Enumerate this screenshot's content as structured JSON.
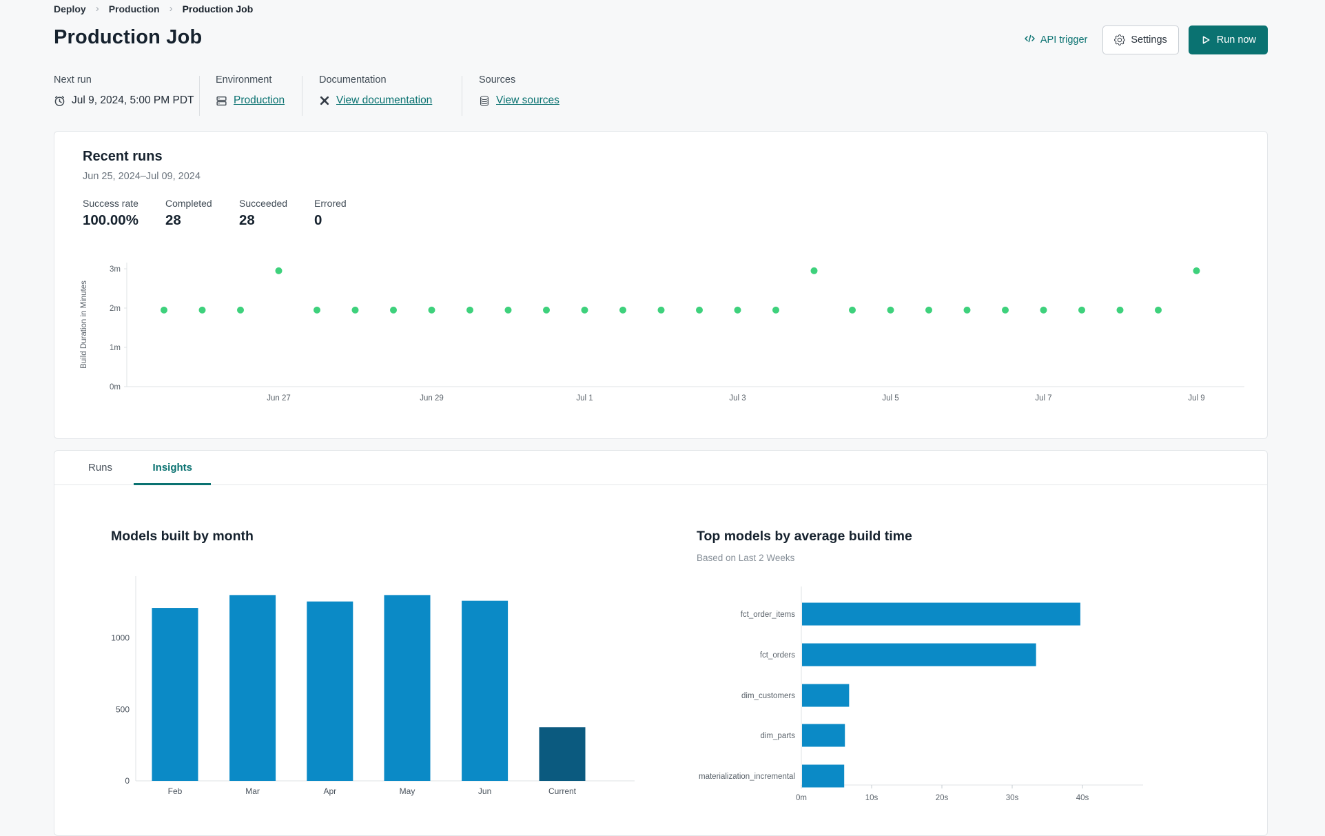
{
  "colors": {
    "accent_teal": "#0a7271",
    "point_green": "#3ed17c",
    "bar_blue": "#0b8ac6",
    "bar_navy": "#0b5a7f"
  },
  "breadcrumb": {
    "deploy": "Deploy",
    "production": "Production",
    "current": "Production Job"
  },
  "header": {
    "title": "Production Job",
    "api_trigger_label": "API trigger",
    "api_trigger_icon": "code-icon",
    "settings_label": "Settings",
    "settings_icon": "gear-icon",
    "run_now_label": "Run now",
    "run_now_icon": "play-icon"
  },
  "meta": {
    "next_run": {
      "label": "Next run",
      "value": "Jul 9, 2024, 5:00 PM PDT",
      "icon": "clock-icon"
    },
    "environment": {
      "label": "Environment",
      "value": "Production",
      "icon": "environment-icon"
    },
    "documentation": {
      "label": "Documentation",
      "value": "View documentation",
      "icon": "dbt-docs-icon"
    },
    "sources": {
      "label": "Sources",
      "value": "View sources",
      "icon": "database-icon"
    }
  },
  "recent_runs": {
    "title": "Recent runs",
    "date_range": "Jun 25, 2024–Jul 09, 2024",
    "stats": {
      "success_rate": {
        "label": "Success rate",
        "value": "100.00%"
      },
      "completed": {
        "label": "Completed",
        "value": "28"
      },
      "succeeded": {
        "label": "Succeeded",
        "value": "28"
      },
      "errored": {
        "label": "Errored",
        "value": "0"
      }
    }
  },
  "tabs": {
    "runs": "Runs",
    "insights": "Insights",
    "active": "Insights"
  },
  "chart_data": [
    {
      "id": "run-durations",
      "type": "scatter",
      "title": "Recent runs",
      "ylabel": "Build Duration in Minutes",
      "yticks": [
        "0m",
        "1m",
        "2m",
        "3m"
      ],
      "ylim_minutes": [
        0,
        3.3
      ],
      "xticklabels": [
        "Jun 27",
        "Jun 29",
        "Jul 1",
        "Jul 3",
        "Jul 5",
        "Jul 7",
        "Jul 9"
      ],
      "x_range": [
        "Jun 25, 2024",
        "Jul 09, 2024"
      ],
      "grid": false,
      "point_color": "#3ed17c",
      "points_minutes": [
        1.95,
        1.95,
        1.95,
        2.95,
        1.95,
        1.95,
        1.95,
        1.95,
        1.95,
        1.95,
        1.95,
        1.95,
        1.95,
        1.95,
        1.95,
        1.95,
        1.95,
        2.95,
        1.95,
        1.95,
        1.95,
        1.95,
        1.95,
        1.95,
        1.95,
        1.95,
        1.95,
        2.95
      ]
    },
    {
      "id": "models-by-month",
      "type": "bar",
      "title": "Models built by month",
      "categories": [
        "Feb",
        "Mar",
        "Apr",
        "May",
        "Jun",
        "Current"
      ],
      "values": [
        1210,
        1300,
        1255,
        1300,
        1260,
        375
      ],
      "yticks": [
        0,
        500,
        1000
      ],
      "ylim": [
        0,
        1400
      ],
      "grid": false,
      "bar_color": "#0b8ac6",
      "current_bar_color": "#0b5a7f"
    },
    {
      "id": "top-models",
      "type": "horizontal-bar",
      "title": "Top models by average build time",
      "subtitle": "Based on Last 2 Weeks",
      "categories": [
        "fct_order_items",
        "fct_orders",
        "dim_customers",
        "dim_parts",
        "materialization_incremental"
      ],
      "values_seconds": [
        39.6,
        33.3,
        6.7,
        6.1,
        6.0
      ],
      "xticks": [
        "0m",
        "10s",
        "20s",
        "30s",
        "40s"
      ],
      "xlim_seconds": [
        0,
        44
      ],
      "grid": false,
      "bar_color": "#0b8ac6"
    }
  ]
}
